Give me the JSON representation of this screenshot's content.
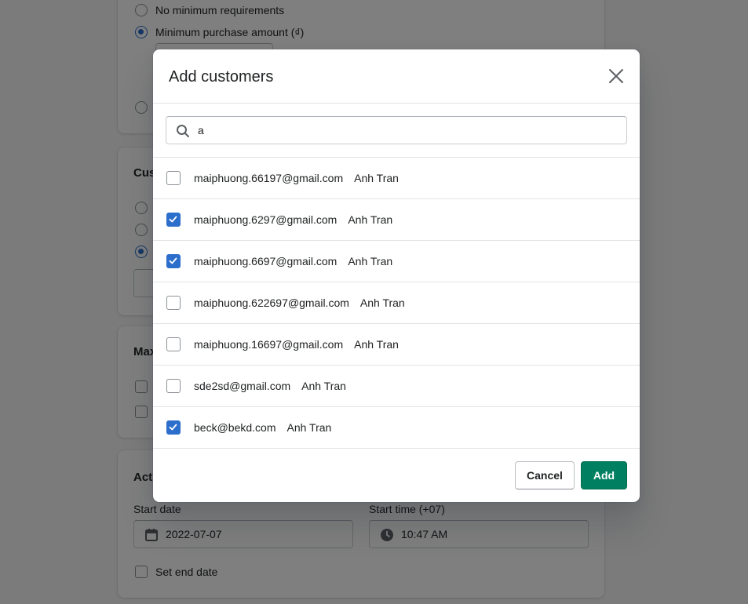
{
  "background": {
    "minimum_requirements": {
      "options": [
        "No minimum requirements",
        "Minimum purchase amount (₫)"
      ]
    },
    "customer_eligibility": {
      "heading_partial": "Cus"
    },
    "max_uses": {
      "heading_partial": "Max"
    },
    "active_dates": {
      "heading_partial": "Act",
      "start_date_label": "Start date",
      "start_date_value": "2022-07-07",
      "start_time_label": "Start time (+07)",
      "start_time_value": "10:47 AM",
      "set_end_date_label": "Set end date"
    }
  },
  "modal": {
    "title": "Add customers",
    "search_value": "a",
    "customers": [
      {
        "email": "maiphuong.66197@gmail.com",
        "name": "Anh Tran",
        "checked": false
      },
      {
        "email": "maiphuong.6297@gmail.com",
        "name": "Anh Tran",
        "checked": true
      },
      {
        "email": "maiphuong.6697@gmail.com",
        "name": "Anh Tran",
        "checked": true
      },
      {
        "email": "maiphuong.622697@gmail.com",
        "name": "Anh Tran",
        "checked": false
      },
      {
        "email": "maiphuong.16697@gmail.com",
        "name": "Anh Tran",
        "checked": false
      },
      {
        "email": "sde2sd@gmail.com",
        "name": "Anh Tran",
        "checked": false
      },
      {
        "email": "beck@bekd.com",
        "name": "Anh Tran",
        "checked": true
      }
    ],
    "cancel_label": "Cancel",
    "add_label": "Add"
  },
  "colors": {
    "accent_blue": "#2c6ecb",
    "primary_green": "#008060",
    "overlay": "rgba(0,0,0,0.5)"
  },
  "icons": [
    "search-icon",
    "close-icon",
    "checkmark-icon",
    "calendar-icon",
    "clock-icon"
  ]
}
